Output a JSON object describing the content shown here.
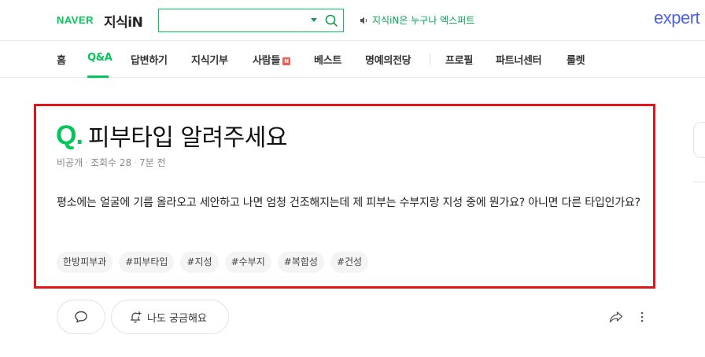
{
  "header": {
    "logo_naver": "NAVER",
    "logo_kin": "지식iN",
    "search_value": "",
    "promo_text": "지식iN은 누구나 엑스퍼트",
    "expert_logo": "expert"
  },
  "nav": {
    "items": [
      {
        "label": "홈"
      },
      {
        "label": "Q&A"
      },
      {
        "label": "답변하기"
      },
      {
        "label": "지식기부"
      },
      {
        "label": "사람들"
      },
      {
        "label": "베스트"
      },
      {
        "label": "명예의전당"
      },
      {
        "label": "프로필"
      },
      {
        "label": "파트너센터"
      },
      {
        "label": "룰렛"
      }
    ],
    "new_badge": "N",
    "active_index": 1
  },
  "question": {
    "q_mark": "Q.",
    "title": "피부타입 알려주세요",
    "meta": {
      "author": "비공개",
      "views": "조회수 28",
      "time": "7분 전"
    },
    "body": "평소에는 얼굴에 기름 올라오고 세안하고 나면 엄청 건조해지는데 제 피부는 수부지랑 지성 중에 뭔가요? 아니면 다른 타입인가요?",
    "tags": [
      "한방피부과",
      "#피부타입",
      "#지성",
      "#수부지",
      "#복합성",
      "#건성"
    ]
  },
  "actions": {
    "curious_label": "나도 궁금해요"
  },
  "colors": {
    "brand_green": "#03c75a",
    "highlight_red": "#e0161b",
    "expert_blue": "#4e63e6"
  }
}
